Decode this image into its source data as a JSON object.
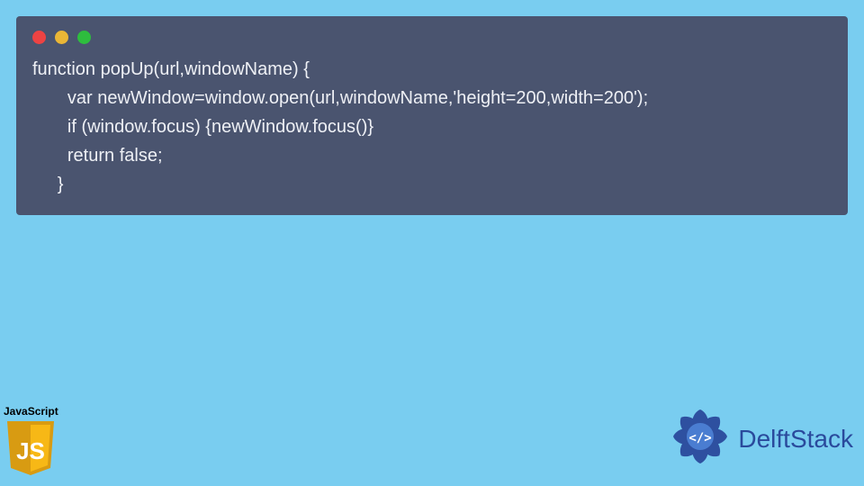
{
  "code": {
    "lines": [
      "function popUp(url,windowName) {",
      "       var newWindow=window.open(url,windowName,'height=200,width=200');",
      "       if (window.focus) {newWindow.focus()}",
      "       return false;",
      "     }"
    ]
  },
  "js_badge": {
    "label": "JavaScript",
    "shield_letters": "JS"
  },
  "delft": {
    "brand": "DelftStack"
  },
  "colors": {
    "background": "#79cdf0",
    "window": "#4a546f",
    "code_text": "#eef0f5",
    "red": "#ed4343",
    "yellow": "#eab636",
    "green": "#2ebd3e",
    "js_yellow": "#f7b816",
    "delft_blue": "#2a4a9c"
  }
}
